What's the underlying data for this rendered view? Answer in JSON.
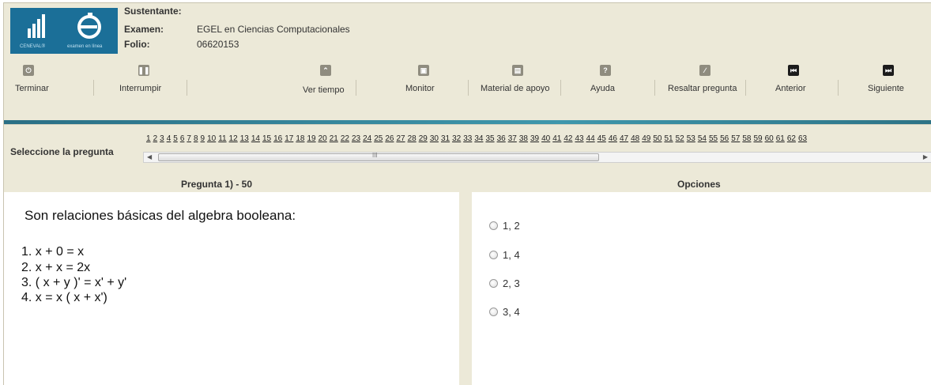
{
  "logos": {
    "ceneval_caption": "CENEVAL®",
    "examen_caption": "examen en línea"
  },
  "info": {
    "sustentante_label": "Sustentante:",
    "sustentante_value": "",
    "examen_label": "Examen:",
    "examen_value": "EGEL en Ciencias Computacionales",
    "folio_label": "Folio:",
    "folio_value": "06620153"
  },
  "toolbar": {
    "terminar": "Terminar",
    "interrumpir": "Interrumpir",
    "ver_tiempo": "Ver tiempo",
    "monitor": "Monitor",
    "material": "Material de apoyo",
    "ayuda": "Ayuda",
    "resaltar": "Resaltar pregunta",
    "anterior": "Anterior",
    "siguiente": "Siguiente"
  },
  "selector": {
    "label": "Seleccione la pregunta",
    "numbers": [
      "1",
      "2",
      "3",
      "4",
      "5",
      "6",
      "7",
      "8",
      "9",
      "10",
      "11",
      "12",
      "13",
      "14",
      "15",
      "16",
      "17",
      "18",
      "19",
      "20",
      "21",
      "22",
      "23",
      "24",
      "25",
      "26",
      "27",
      "28",
      "29",
      "30",
      "31",
      "32",
      "33",
      "34",
      "35",
      "36",
      "37",
      "38",
      "39",
      "40",
      "41",
      "42",
      "43",
      "44",
      "45",
      "46",
      "47",
      "48",
      "49",
      "50",
      "51",
      "52",
      "53",
      "54",
      "55",
      "56",
      "57",
      "58",
      "59",
      "60",
      "61",
      "62",
      "63"
    ],
    "scroll_grip": "III"
  },
  "question": {
    "header": "Pregunta 1) - 50",
    "text": "Son relaciones básicas del algebra booleana:",
    "items": [
      "1. x + 0 = x",
      "2. x + x = 2x",
      "3. ( x + y )'  = x' + y'",
      "4. x = x ( x + x')"
    ]
  },
  "options": {
    "header": "Opciones",
    "choices": [
      "1, 2",
      "1, 4",
      "2, 3",
      "3, 4"
    ]
  }
}
